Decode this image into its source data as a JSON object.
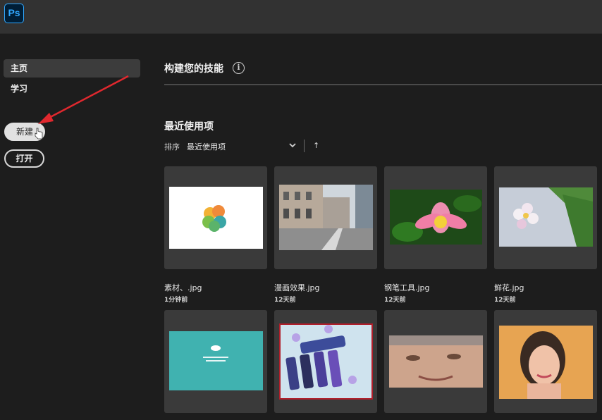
{
  "app": {
    "logo_text": "Ps",
    "brand_color": "#31a8ff"
  },
  "sidebar": {
    "items": [
      {
        "label": "主页",
        "active": true
      },
      {
        "label": "学习",
        "active": false
      }
    ],
    "new_button": "新建",
    "open_button": "打开"
  },
  "main": {
    "skills_title": "构建您的技能",
    "info_icon": "i",
    "recent_title": "最近使用项",
    "sort_label": "排序",
    "sort_value": "最近使用项",
    "sort_direction": "↑",
    "files": [
      {
        "name": "素材、.jpg",
        "time": "1分钟前",
        "icon": "logo-circles"
      },
      {
        "name": "漫画效果.jpg",
        "time": "12天前",
        "icon": "street-photo"
      },
      {
        "name": "钢笔工具.jpg",
        "time": "12天前",
        "icon": "lotus-photo"
      },
      {
        "name": "鲜花.jpg",
        "time": "12天前",
        "icon": "frangipani-photo"
      },
      {
        "name": "",
        "time": "",
        "icon": "teal-cloud-screen"
      },
      {
        "name": "",
        "time": "",
        "icon": "phones-photo"
      },
      {
        "name": "",
        "time": "",
        "icon": "smiling-woman-photo"
      },
      {
        "name": "",
        "time": "",
        "icon": "portrait-photo"
      }
    ]
  }
}
